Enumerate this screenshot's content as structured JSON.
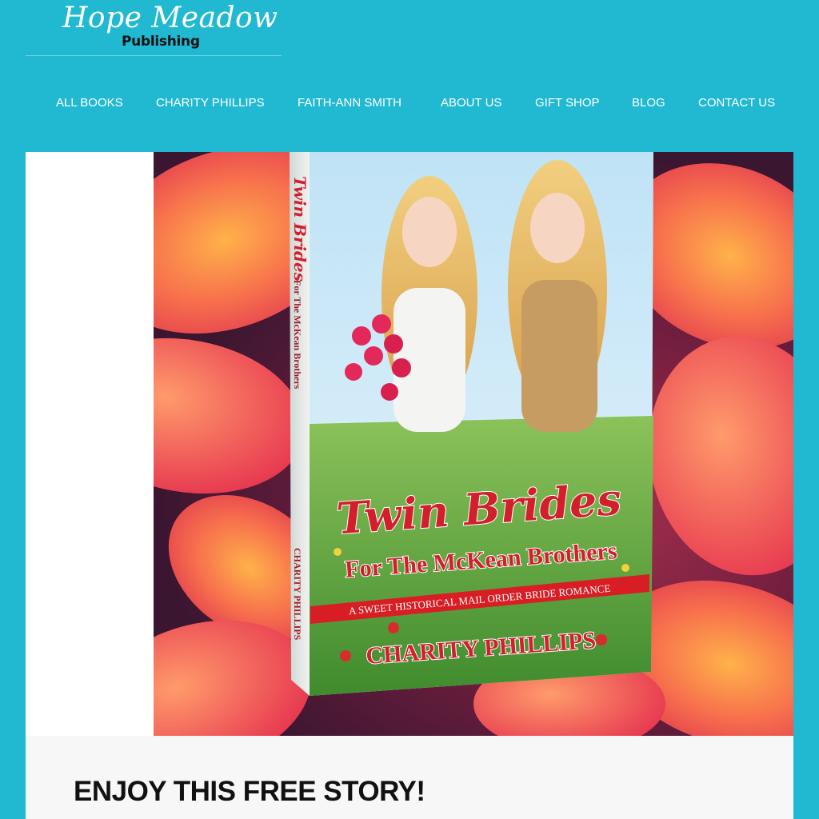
{
  "logo": {
    "script_text": "Hope Meadow",
    "sub_text": "Publishing"
  },
  "nav": {
    "items": [
      {
        "label": "ALL BOOKS"
      },
      {
        "label": "CHARITY PHILLIPS"
      },
      {
        "label": "FAITH-ANN SMITH"
      },
      {
        "label": "ABOUT US"
      },
      {
        "label": "GIFT SHOP"
      },
      {
        "label": "BLOG"
      },
      {
        "label": "CONTACT US"
      }
    ]
  },
  "hero": {
    "book": {
      "title_line1": "Twin Brides",
      "title_line2": "For The McKean Brothers",
      "banner": "A SWEET HISTORICAL MAIL ORDER BRIDE ROMANCE",
      "author": "CHARITY PHILLIPS",
      "spine_title": "Twin Brides",
      "spine_subtitle": "For The McKean Brothers",
      "spine_author": "CHARITY PHILLIPS"
    }
  },
  "main": {
    "heading": "ENJOY THIS FREE STORY!"
  },
  "colors": {
    "page_bg": "#21b9d2",
    "nav_text": "#ffffff",
    "title_red": "#d21f2b",
    "banner_red": "#d81e24"
  }
}
